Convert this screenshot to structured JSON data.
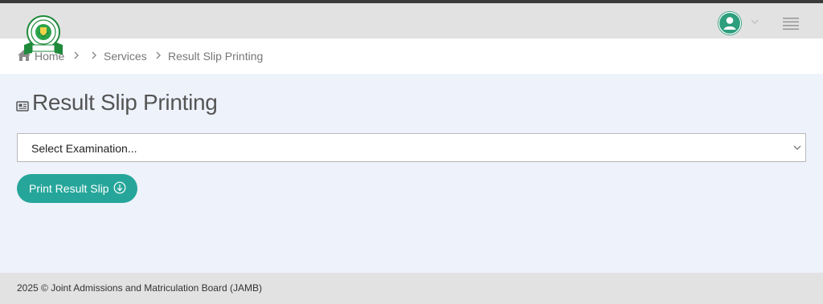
{
  "header": {
    "logo_icon": "jamb-logo-icon",
    "avatar_icon": "user-icon",
    "menu_icon": "hamburger-menu-icon",
    "colors": {
      "accent": "#26a69a",
      "avatar": "#2e9e7c",
      "header_bg": "#e2e2e2"
    }
  },
  "breadcrumb": {
    "home": "Home",
    "services": "Services",
    "current": "Result Slip Printing"
  },
  "main": {
    "title": "Result Slip Printing",
    "title_icon": "document-icon",
    "select": {
      "selected": "Select Examination..."
    },
    "button": {
      "label": "Print Result Slip",
      "icon": "download-circle-icon"
    }
  },
  "footer": {
    "text": "2025 © Joint Admissions and Matriculation Board (JAMB)"
  }
}
